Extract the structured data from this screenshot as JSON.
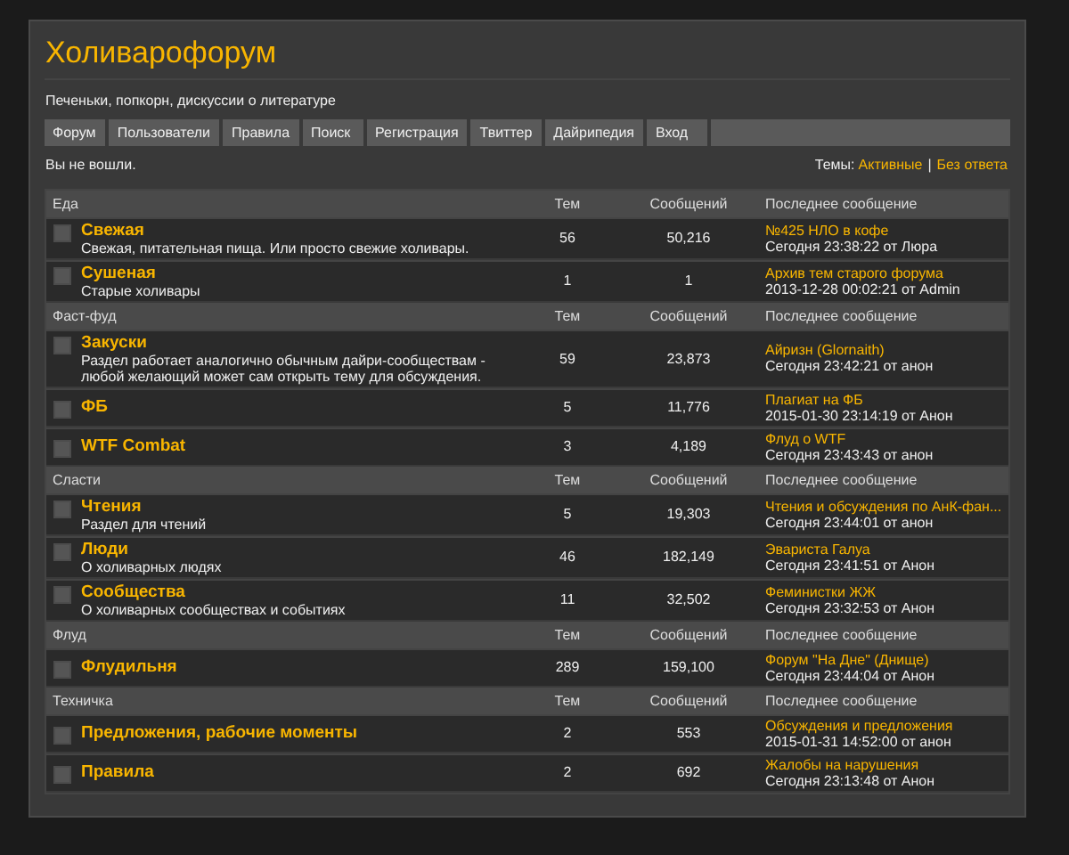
{
  "site": {
    "title": "Холиварофорум",
    "tagline": "Печеньки, попкорн, дискуссии о литературе"
  },
  "nav": [
    {
      "label": "Форум"
    },
    {
      "label": "Пользователи"
    },
    {
      "label": "Правила"
    },
    {
      "label": "Поиск"
    },
    {
      "label": "Регистрация"
    },
    {
      "label": "Твиттер"
    },
    {
      "label": "Дайрипедия"
    },
    {
      "label": "Вход"
    }
  ],
  "status": {
    "login": "Вы не вошли.",
    "topics_label": "Темы:",
    "links": [
      "Активные",
      "Без ответа"
    ],
    "separator": "|"
  },
  "categories": [
    {
      "name": "Еда",
      "columns": [
        "Тем",
        "Сообщений",
        "Последнее сообщение"
      ],
      "forums": [
        {
          "name": "Свежая",
          "description": "Свежая, питательная пища. Или просто свежие холивары.",
          "topics": "56",
          "posts": "50,216",
          "last_title": "№425 НЛО в кофе",
          "last_meta": "Сегодня 23:38:22 от Люра"
        },
        {
          "name": "Сушеная",
          "description": "Старые холивары",
          "topics": "1",
          "posts": "1",
          "last_title": "Архив тем старого форума",
          "last_meta": "2013-12-28 00:02:21 от Admin"
        }
      ]
    },
    {
      "name": "Фаст-фуд",
      "columns": [
        "Тем",
        "Сообщений",
        "Последнее сообщение"
      ],
      "forums": [
        {
          "name": "Закуски",
          "description": "Раздел работает аналогично обычным дайри-сообществам - любой желающий может сам открыть тему для обсуждения.",
          "topics": "59",
          "posts": "23,873",
          "last_title": "Айризн (Glornaith)",
          "last_meta": "Сегодня 23:42:21 от анон"
        },
        {
          "name": "ФБ",
          "topics": "5",
          "posts": "11,776",
          "last_title": "Плагиат на ФБ",
          "last_meta": "2015-01-30 23:14:19 от Анон"
        },
        {
          "name": "WTF Combat",
          "topics": "3",
          "posts": "4,189",
          "last_title": "Флуд о WTF",
          "last_meta": "Сегодня 23:43:43 от анон"
        }
      ]
    },
    {
      "name": "Сласти",
      "columns": [
        "Тем",
        "Сообщений",
        "Последнее сообщение"
      ],
      "forums": [
        {
          "name": "Чтения",
          "description": "Раздел для чтений",
          "topics": "5",
          "posts": "19,303",
          "last_title": "Чтения и обсуждения по АнК-фан...",
          "last_meta": "Сегодня 23:44:01 от анон"
        },
        {
          "name": "Люди",
          "description": "О холиварных людях",
          "topics": "46",
          "posts": "182,149",
          "last_title": "Эвариста Галуа",
          "last_meta": "Сегодня 23:41:51 от Анон"
        },
        {
          "name": "Сообщества",
          "description": "О холиварных сообществах и событиях",
          "topics": "11",
          "posts": "32,502",
          "last_title": "Феминистки ЖЖ",
          "last_meta": "Сегодня 23:32:53 от Анон"
        }
      ]
    },
    {
      "name": "Флуд",
      "columns": [
        "Тем",
        "Сообщений",
        "Последнее сообщение"
      ],
      "forums": [
        {
          "name": "Флудильня",
          "topics": "289",
          "posts": "159,100",
          "last_title": "Форум \"На Дне\" (Днище)",
          "last_meta": "Сегодня 23:44:04 от Анон"
        }
      ]
    },
    {
      "name": "Техничка",
      "columns": [
        "Тем",
        "Сообщений",
        "Последнее сообщение"
      ],
      "forums": [
        {
          "name": "Предложения, рабочие моменты",
          "topics": "2",
          "posts": "553",
          "last_title": "Обсуждения и предложения",
          "last_meta": "2015-01-31 14:52:00 от анон"
        },
        {
          "name": "Правила",
          "topics": "2",
          "posts": "692",
          "last_title": "Жалобы на нарушения",
          "last_meta": "Сегодня 23:13:48 от Анон"
        }
      ]
    }
  ]
}
